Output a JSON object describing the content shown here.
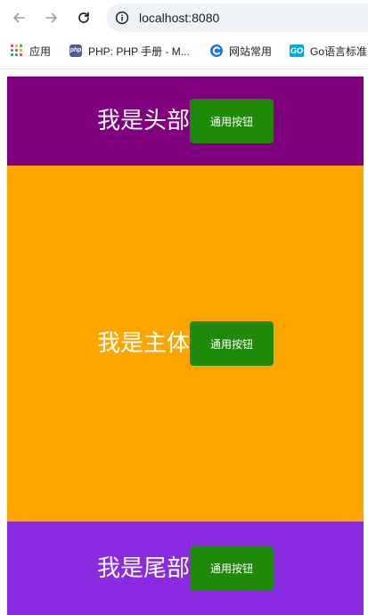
{
  "browser": {
    "address": "localhost:8080",
    "bookmarks": [
      {
        "label": "应用",
        "icon": "apps-grid-icon"
      },
      {
        "label": "PHP: PHP 手册 - M...",
        "icon": "php-icon"
      },
      {
        "label": "网站常用",
        "icon": "site-icon"
      },
      {
        "label": "Go语言标准",
        "icon": "go-icon"
      }
    ],
    "php_icon_text": "php",
    "go_icon_text": "GO"
  },
  "page": {
    "header": {
      "title": "我是头部",
      "button_label": "通用按钮",
      "bg": "#800080"
    },
    "main": {
      "title": "我是主体",
      "button_label": "通用按钮",
      "bg": "#ffa500"
    },
    "footer": {
      "title": "我是尾部",
      "button_label": "通用按钮",
      "bg": "#8a2be2"
    },
    "button_color": "#1f8a0a"
  }
}
